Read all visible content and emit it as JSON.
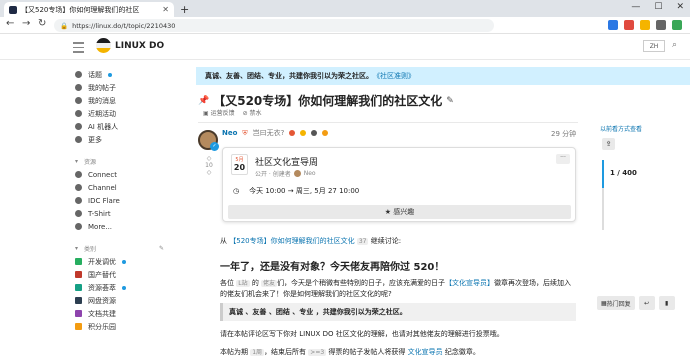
{
  "browser": {
    "tab_title": "【又520专场】你如何理解我们的社区",
    "url": "https://linux.do/t/topic/2210430"
  },
  "header": {
    "brand": "LINUX DO",
    "lang": "ZH"
  },
  "sidebar": {
    "items": [
      {
        "label": "话题",
        "icon": "topics-icon",
        "dot": true
      },
      {
        "label": "我的帖子",
        "icon": "user-icon"
      },
      {
        "label": "我的消息",
        "icon": "inbox-icon"
      },
      {
        "label": "近期活动",
        "icon": "activity-icon"
      },
      {
        "label": "AI 机器人",
        "icon": "robot-icon"
      },
      {
        "label": "更多",
        "icon": "more-icon"
      }
    ],
    "resources_head": "资源",
    "resources": [
      {
        "label": "Connect",
        "icon": "connect-icon"
      },
      {
        "label": "Channel",
        "icon": "channel-icon"
      },
      {
        "label": "IDC Flare",
        "icon": "idc-icon"
      },
      {
        "label": "T-Shirt",
        "icon": "tshirt-icon"
      },
      {
        "label": "More...",
        "icon": "more-icon"
      }
    ],
    "categories_head": "类别",
    "categories": [
      {
        "label": "开发调优",
        "color": "#27ae60",
        "dot": true
      },
      {
        "label": "国产替代",
        "color": "#c0392b"
      },
      {
        "label": "资源荟萃",
        "color": "#16a085",
        "dot": true
      },
      {
        "label": "网盘资源",
        "color": "#2c3e50"
      },
      {
        "label": "文档共建",
        "color": "#8e44ad"
      },
      {
        "label": "积分乐园",
        "color": "#f39c12"
      }
    ]
  },
  "banner": {
    "text": "真诚、友善、团结、专业，共建你我引以为荣之社区。",
    "link": "《社区准则》"
  },
  "topic": {
    "title": "【又520专场】你如何理解我们的社区文化",
    "tags": [
      "运营反馈",
      "禁水"
    ]
  },
  "post": {
    "author": "Neo",
    "status": "岂曰无衣?",
    "date": "29 分钟",
    "votes": "10",
    "event": {
      "month": "5月",
      "day": "20",
      "name": "社区文化宣导周",
      "meta": "公开 · 创建者",
      "creator": "Neo",
      "time": "今天 10:00 → 周三, 5月 27 10:00",
      "interest": "感兴趣"
    },
    "body": {
      "intro_link": "【520专场】你如何理解我们的社区文化",
      "intro_num": "37",
      "intro_rest": "继续讨论:",
      "heading": "一年了，还是没有对象？今天佬友再陪你过 520！",
      "p2_a": "各位",
      "p2_badge1": "L站",
      "p2_b": "的",
      "p2_badge2": "佬友",
      "p2_c": "们，今天是个稍微有些特别的日子，应该充满爱的日子",
      "p2_link": "【文化宣导员】",
      "p2_d": "徽章再次登场，后续加入的佬友们机会来了！你是如何理解我们的社区文化的呢?",
      "quote": "真诚 、友善 、团结 、专业 ，共建你我引以为荣之社区。",
      "p3": "请在本帖评论区写下你对 LINUX DO 社区文化的理解，也请对其他佬友的理解进行投票哦。",
      "p4_a": "本帖为期",
      "p4_badge1": "1周",
      "p4_b": "，结束后所有",
      "p4_badge2": ">=3",
      "p4_c": "得票的帖子发帖人将获得",
      "p4_link": "文化宣导员",
      "p4_d": "纪念徽章。"
    }
  },
  "timeline": {
    "top": "以前看方式查看",
    "count": "1 / 400"
  },
  "footer": {
    "hot_reply": "热门回复"
  }
}
